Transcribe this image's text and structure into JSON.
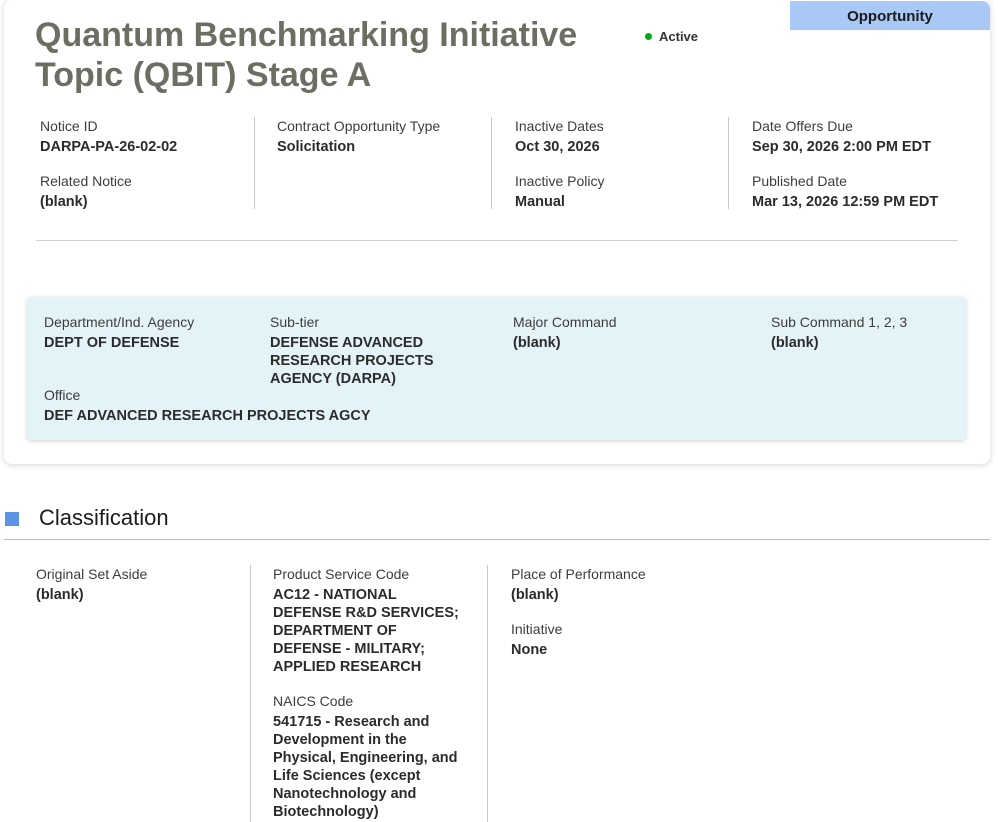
{
  "header": {
    "badge": "Opportunity",
    "title": "Quantum Benchmarking Initiative Topic (QBIT) Stage A",
    "status": "Active",
    "status_color": "#00a91c"
  },
  "overview": {
    "notice_id": {
      "label": "Notice ID",
      "value": "DARPA-PA-26-02-02"
    },
    "related_notice": {
      "label": "Related Notice",
      "value": "(blank)"
    },
    "contract_type": {
      "label": "Contract Opportunity Type",
      "value": "Solicitation"
    },
    "inactive_dates": {
      "label": "Inactive Dates",
      "value": "Oct 30, 2026"
    },
    "inactive_policy": {
      "label": "Inactive Policy",
      "value": "Manual"
    },
    "date_offers_due": {
      "label": "Date Offers Due",
      "value": "Sep 30, 2026 2:00 PM EDT"
    },
    "published_date": {
      "label": "Published Date",
      "value": "Mar 13, 2026 12:59 PM EDT"
    }
  },
  "agency": {
    "department": {
      "label": "Department/Ind. Agency",
      "value": "DEPT OF DEFENSE"
    },
    "sub_tier": {
      "label": "Sub-tier",
      "value": "DEFENSE ADVANCED RESEARCH PROJECTS AGENCY (DARPA)"
    },
    "major_command": {
      "label": "Major Command",
      "value": "(blank)"
    },
    "sub_command": {
      "label": "Sub Command 1, 2, 3",
      "value": "(blank)"
    },
    "office": {
      "label": "Office",
      "value": "DEF ADVANCED RESEARCH PROJECTS AGCY"
    }
  },
  "classification": {
    "heading": "Classification",
    "accent_color": "#5b93e6",
    "original_set_aside": {
      "label": "Original Set Aside",
      "value": "(blank)"
    },
    "product_service_code": {
      "label": "Product Service Code",
      "value": "AC12 - NATIONAL DEFENSE R&D SERVICES; DEPARTMENT OF DEFENSE - MILITARY; APPLIED RESEARCH"
    },
    "naics_code": {
      "label": "NAICS Code",
      "value": "541715 - Research and Development in the Physical, Engineering, and Life Sciences (except Nanotechnology and Biotechnology)"
    },
    "place_of_performance": {
      "label": "Place of Performance",
      "value": "(blank)"
    },
    "initiative": {
      "label": "Initiative",
      "value": "None"
    }
  }
}
